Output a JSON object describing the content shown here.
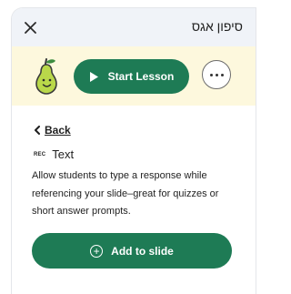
{
  "header": {
    "title": "סיפון אגס",
    "close_icon": "close-icon"
  },
  "toolbar": {
    "logo_icon": "pear-logo-icon",
    "start_label": "Start Lesson",
    "more_icon": "more-horizontal-icon"
  },
  "content": {
    "back_label": "Back",
    "type_icon_text": "REC",
    "type_label": "Text",
    "description": "Allow students to type a response while referencing your slide–great for quizzes or short answer prompts.",
    "add_label": "Add to slide"
  },
  "colors": {
    "accent": "#1e7b55",
    "pear_bar_bg": "#fdf8dd",
    "header_bg": "#f0f3f8"
  }
}
